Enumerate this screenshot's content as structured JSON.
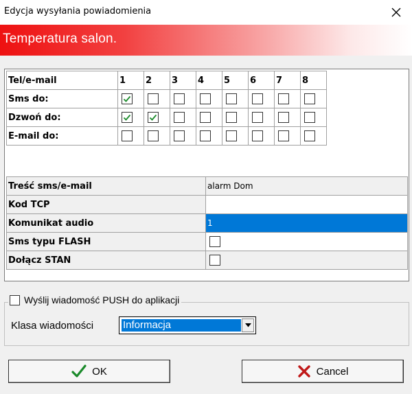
{
  "window": {
    "title": "Edycja wysyłania powiadomienia",
    "close_icon": "close-icon"
  },
  "banner": {
    "text": "Temperatura salon."
  },
  "recipients": {
    "header_label": "Tel/e-mail",
    "columns": [
      "1",
      "2",
      "3",
      "4",
      "5",
      "6",
      "7",
      "8"
    ],
    "rows": [
      {
        "label": "Sms do:",
        "checked": [
          true,
          false,
          false,
          false,
          false,
          false,
          false,
          false
        ]
      },
      {
        "label": "Dzwoń do:",
        "checked": [
          true,
          true,
          false,
          false,
          false,
          false,
          false,
          false
        ]
      },
      {
        "label": "E-mail do:",
        "checked": [
          false,
          false,
          false,
          false,
          false,
          false,
          false,
          false
        ]
      }
    ]
  },
  "properties": {
    "message_label": "Treść sms/e-mail",
    "message_value": "alarm Dom",
    "tcp_label": "Kod TCP",
    "tcp_value": "",
    "audio_label": "Komunikat audio",
    "audio_value": "1",
    "flash_label": "Sms typu FLASH",
    "flash_checked": false,
    "status_label": "Dołącz STAN",
    "status_checked": false
  },
  "push": {
    "label": "Wyślij wiadomość PUSH do aplikacji",
    "checked": false,
    "class_label": "Klasa wiadomości",
    "class_value": "Informacja"
  },
  "buttons": {
    "ok_label": "OK",
    "cancel_label": "Cancel"
  },
  "colors": {
    "banner_red": "#ee1111",
    "selection": "#0078d7",
    "check_green": "#1a8a2a",
    "cancel_red": "#c01818"
  }
}
